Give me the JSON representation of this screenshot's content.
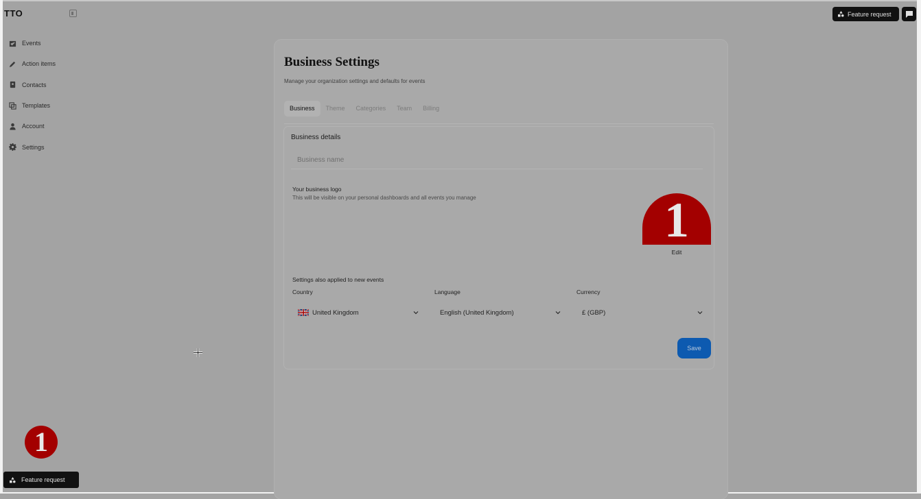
{
  "app": {
    "brand": "TTO",
    "logo_glyph": "1"
  },
  "sidebar": {
    "items": [
      {
        "label": "Events",
        "icon": "calendar-check-icon"
      },
      {
        "label": "Action items",
        "icon": "pencil-icon"
      },
      {
        "label": "Contacts",
        "icon": "contact-book-icon"
      },
      {
        "label": "Templates",
        "icon": "copy-icon"
      },
      {
        "label": "Account",
        "icon": "user-icon"
      },
      {
        "label": "Settings",
        "icon": "gear-icon"
      }
    ],
    "feature_request_label": "Feature request"
  },
  "header": {
    "feature_request_label": "Feature request"
  },
  "main": {
    "title": "Business Settings",
    "subtitle": "Manage your organization settings and defaults for events",
    "tabs": [
      {
        "label": "Business",
        "active": true
      },
      {
        "label": "Theme",
        "active": false
      },
      {
        "label": "Categories",
        "active": false
      },
      {
        "label": "Team",
        "active": false
      },
      {
        "label": "Billing",
        "active": false
      }
    ],
    "business_details": {
      "title": "Business details",
      "business_name_placeholder": "Business name",
      "business_name_value": "",
      "logo_title": "Your business logo",
      "logo_description": "This will be visible on your personal dashboards and all events you manage",
      "edit_label": "Edit"
    },
    "defaults": {
      "note": "Settings also applied to new events",
      "country_label": "Country",
      "country_value": "United Kingdom",
      "language_label": "Language",
      "language_value": "English (United Kingdom)",
      "currency_label": "Currency",
      "currency_value": "£ (GBP)"
    },
    "save_label": "Save"
  },
  "colors": {
    "brand_red": "#a30000",
    "primary_blue": "#0d5ab0",
    "dark_button": "#111111"
  }
}
